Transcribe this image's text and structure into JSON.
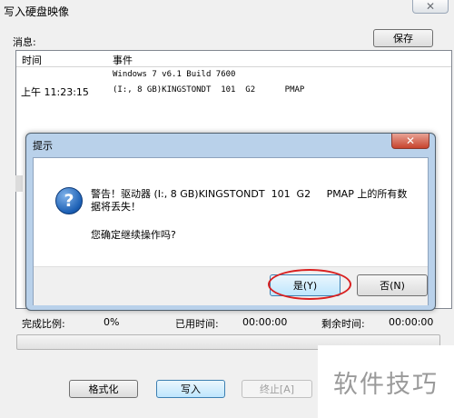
{
  "window": {
    "title": "写入硬盘映像",
    "close_glyph": "✕"
  },
  "messages": {
    "label": "消息:",
    "save_label": "保存",
    "columns": [
      "时间",
      "事件"
    ],
    "rows": [
      {
        "time": "",
        "event": "Windows 7 v6.1 Build 7600"
      },
      {
        "time": "上午 11:23:15",
        "event": "(I:, 8 GB)KINGSTONDT  101  G2      PMAP"
      }
    ]
  },
  "progress": {
    "complete_label": "完成比例:",
    "complete_value": "0%",
    "elapsed_label": "已用时间:",
    "elapsed_value": "00:00:00",
    "remaining_label": "剩余时间:",
    "remaining_value": "00:00:00",
    "fraction": 0
  },
  "buttons": {
    "format": "格式化",
    "write": "写入",
    "abort": "终止[A]"
  },
  "dialog": {
    "title": "提示",
    "close_glyph": "✕",
    "warning_line1": "警告！驱动器 (I:, 8 GB)KINGSTONDT  101  G2     PMAP 上的所有数",
    "warning_line2": "据将丢失！",
    "confirm": "您确定继续操作吗?",
    "yes": "是(Y)",
    "no": "否(N)",
    "icon": "question-icon",
    "highlight_color": "#d92020"
  },
  "watermark": "软件技巧"
}
